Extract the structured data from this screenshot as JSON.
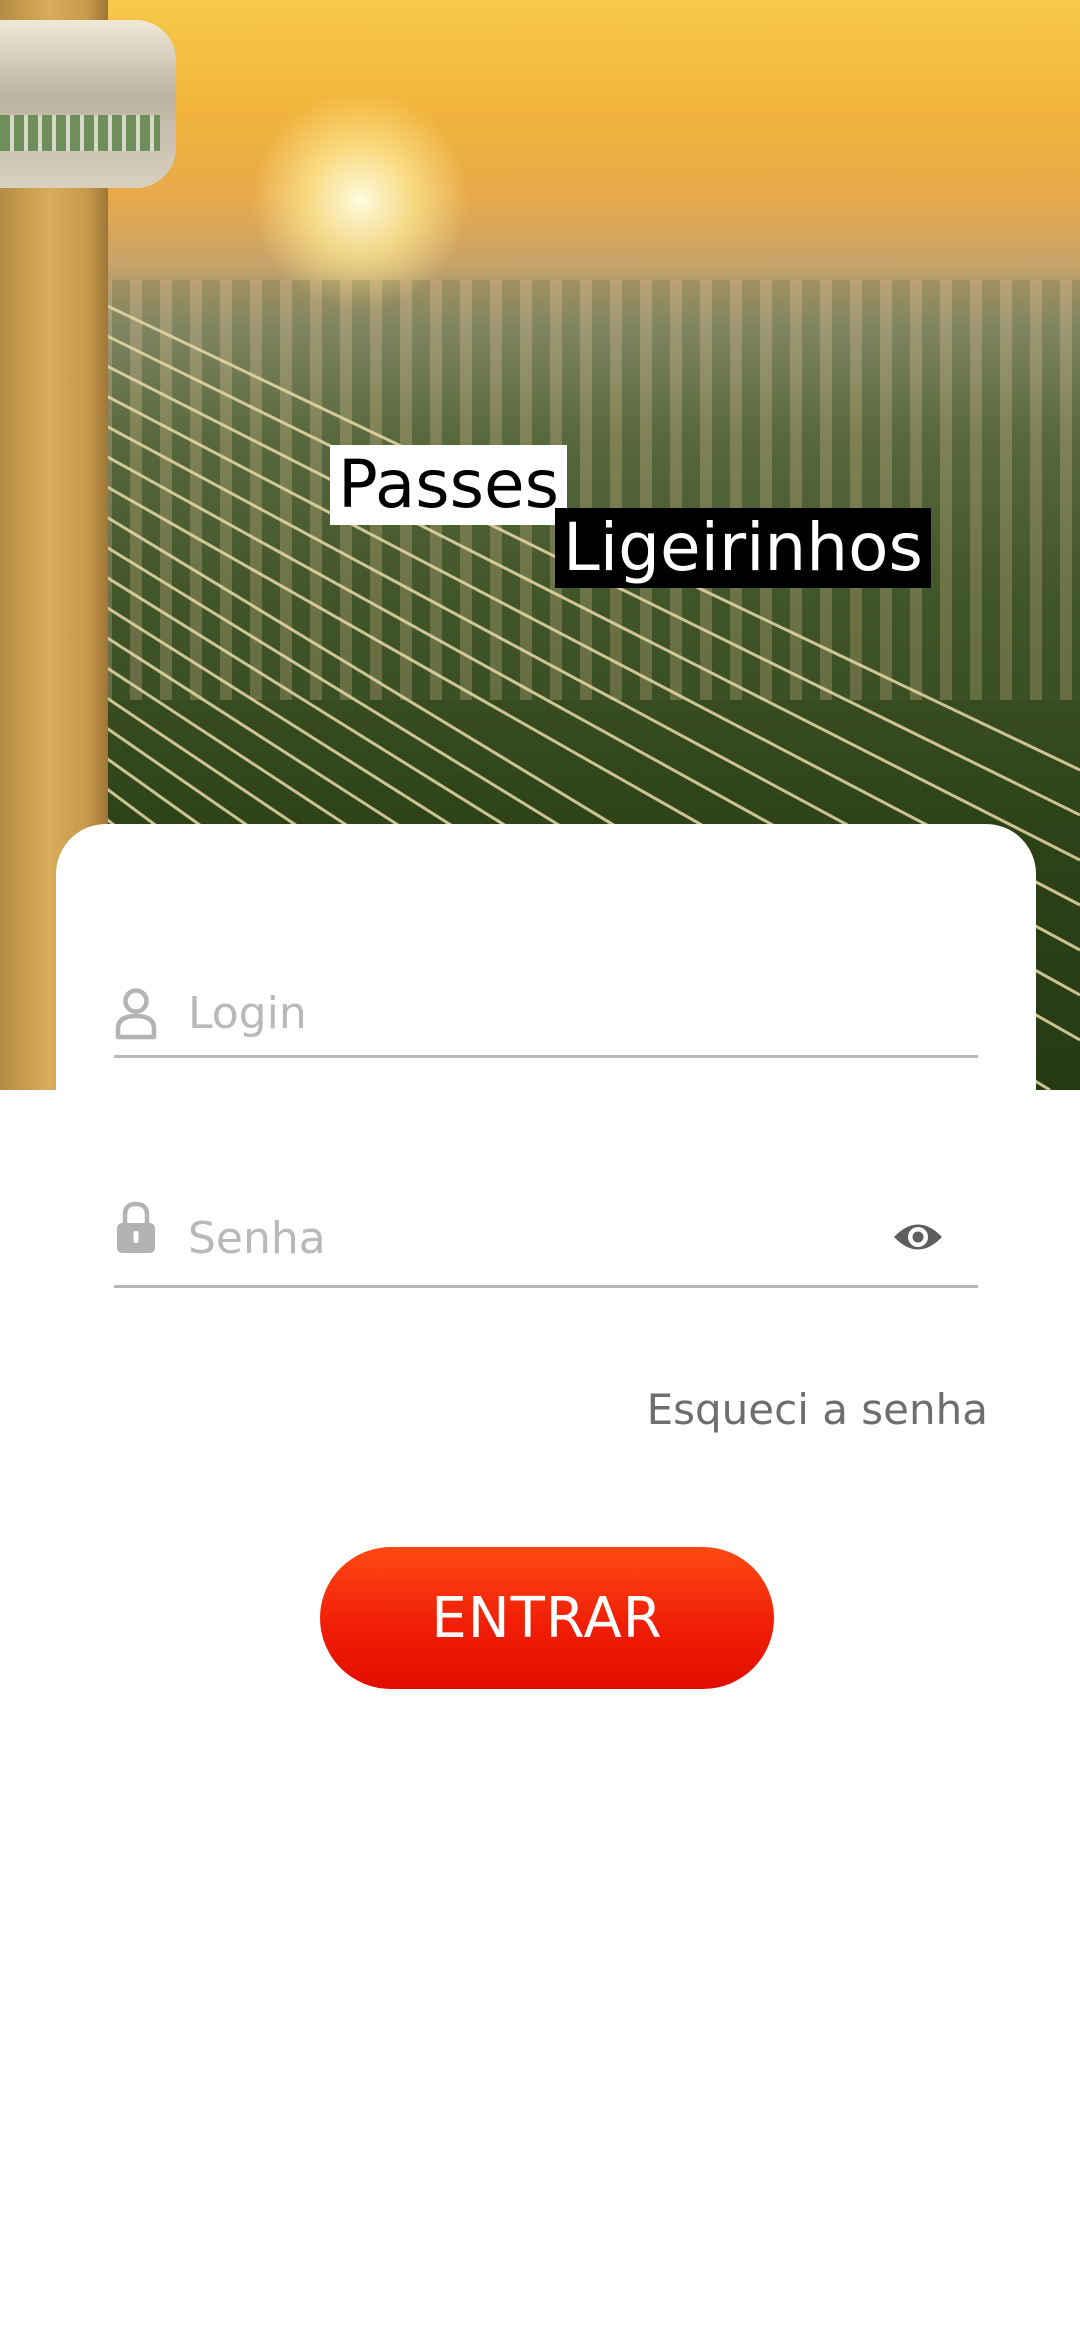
{
  "app_title": {
    "line1": "Passes",
    "line2": "Ligeirinhos"
  },
  "login_field": {
    "placeholder": "Login",
    "icon": "user-icon"
  },
  "password_field": {
    "placeholder": "Senha",
    "icon": "lock-icon",
    "toggle_icon": "eye-icon"
  },
  "forgot_password_label": "Esqueci a senha",
  "submit_label": "ENTRAR",
  "colors": {
    "accent": "#f01e06",
    "placeholder": "#b9b9b9",
    "underline": "#b8b8b8",
    "link": "#6e6e6e"
  }
}
